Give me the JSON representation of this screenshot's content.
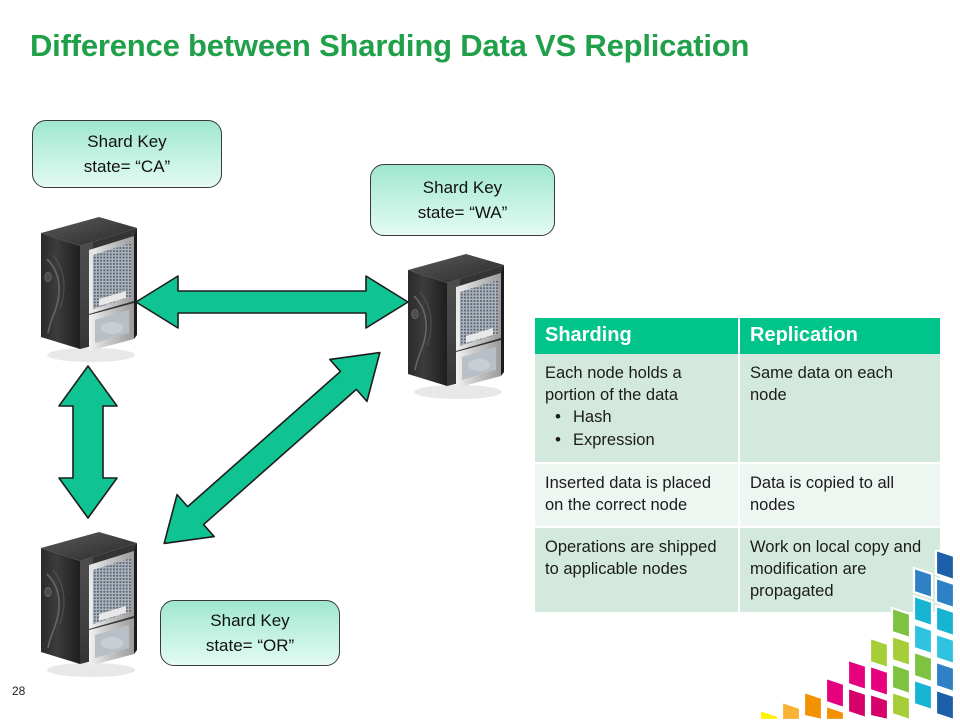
{
  "slide": {
    "title": "Difference between Sharding Data VS Replication",
    "page_number": "28",
    "title_color": "#21a04a",
    "background_color": "#ffffff"
  },
  "callouts": [
    {
      "id": "ca",
      "line1": "Shard Key",
      "line2": "state= “CA”"
    },
    {
      "id": "wa",
      "line1": "Shard Key",
      "line2": "state= “WA”"
    },
    {
      "id": "or",
      "line1": "Shard Key",
      "line2": "state= “OR”"
    }
  ],
  "servers": [
    {
      "id": "server-ca",
      "label": "server-tower-ca"
    },
    {
      "id": "server-wa",
      "label": "server-tower-wa"
    },
    {
      "id": "server-or",
      "label": "server-tower-or"
    }
  ],
  "arrows": {
    "color": "#0fc492",
    "outline": "#1d1d1d",
    "items": [
      {
        "id": "arrow-horizontal",
        "direction": "double",
        "orientation": "horizontal"
      },
      {
        "id": "arrow-vertical",
        "direction": "double",
        "orientation": "vertical"
      },
      {
        "id": "arrow-diagonal",
        "direction": "double",
        "orientation": "diagonal"
      }
    ]
  },
  "table": {
    "header_bg": "#01c48a",
    "row_shade_a": "#d3e9dd",
    "row_shade_b": "#edf6f1",
    "headers": [
      "Sharding",
      "Replication"
    ],
    "rows": [
      {
        "sharding": "Each node holds a portion of the data",
        "sharding_bullets": [
          "Hash",
          "Expression"
        ],
        "replication": "Same data on each node"
      },
      {
        "sharding": "Inserted data is placed on the correct node",
        "sharding_bullets": [],
        "replication": "Data is copied to all nodes"
      },
      {
        "sharding": "Operations are shipped to applicable nodes",
        "sharding_bullets": [],
        "replication": "Work on local copy and modification are propagated"
      }
    ]
  },
  "decoration": {
    "name": "corner-fan-decoration",
    "colors": [
      "#1d5fa8",
      "#2f80c4",
      "#18b4d4",
      "#30c3e0",
      "#7ec242",
      "#a6ce39",
      "#e6007e",
      "#d6006a",
      "#f39200",
      "#f9b233",
      "#fff200"
    ]
  }
}
